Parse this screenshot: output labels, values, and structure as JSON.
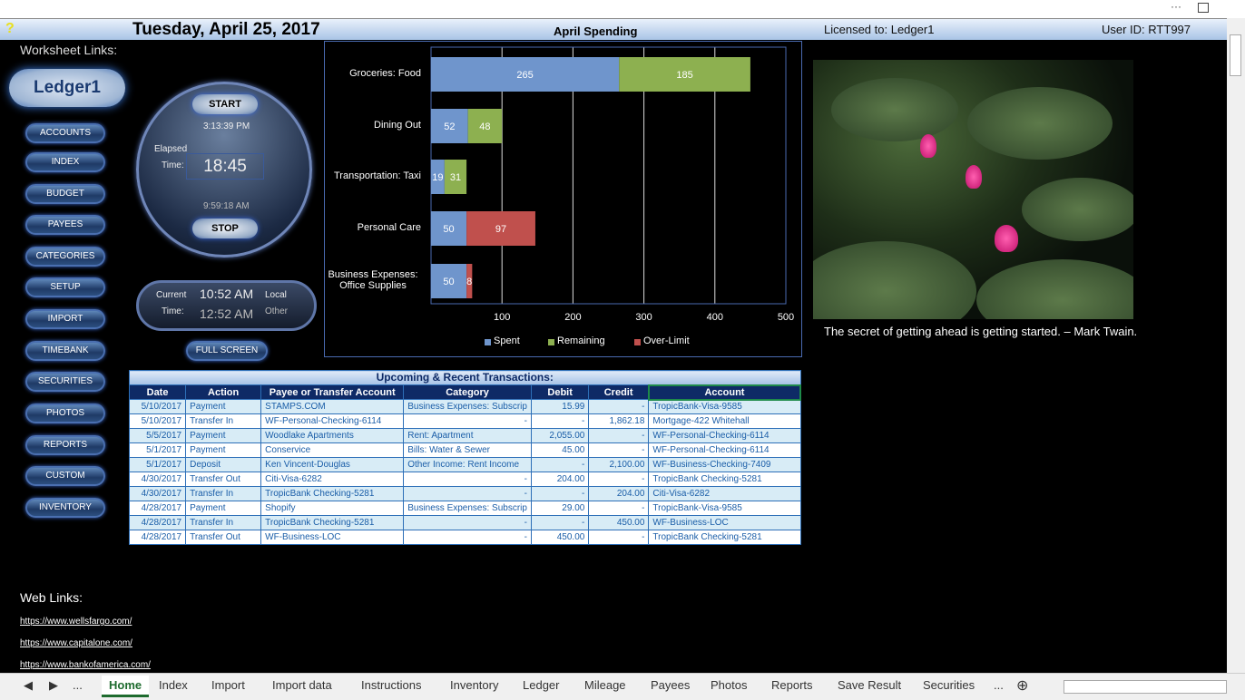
{
  "window": {
    "menu_icon": "more-options-icon",
    "restore_icon": "restore-window-icon"
  },
  "header": {
    "help_icon": "?",
    "date": "Tuesday, April 25, 2017",
    "licensed": "Licensed to:  Ledger1",
    "user": "User ID:  RTT997"
  },
  "sidebar": {
    "title": "Worksheet Links:",
    "logo": "Ledger1",
    "items": [
      "ACCOUNTS",
      "INDEX",
      "BUDGET",
      "PAYEES",
      "CATEGORIES",
      "SETUP",
      "IMPORT",
      "TIMEBANK",
      "SECURITIES",
      "PHOTOS",
      "REPORTS",
      "CUSTOM",
      "INVENTORY"
    ]
  },
  "timer": {
    "start": "START",
    "start_time": "3:13:39 PM",
    "elapsed_l1": "Elapsed",
    "elapsed_l2": "Time:",
    "elapsed": "18:45",
    "stop_time": "9:59:18 AM",
    "stop": "STOP"
  },
  "current": {
    "l1": "Current",
    "l2": "Time:",
    "local": "10:52 AM",
    "other": "12:52 AM",
    "local_l": "Local",
    "other_l": "Other"
  },
  "full_screen": "FULL SCREEN",
  "chart_data": {
    "type": "bar",
    "orientation": "horizontal",
    "stacked": true,
    "title": "April Spending",
    "categories": [
      "Groceries: Food",
      "Dining Out",
      "Transportation: Taxi",
      "Personal Care",
      "Business Expenses: Office Supplies"
    ],
    "series": [
      {
        "name": "Spent",
        "color": "#6f95cc",
        "values": [
          265,
          52,
          19,
          50,
          50
        ]
      },
      {
        "name": "Remaining",
        "color": "#8db050",
        "values": [
          185,
          48,
          31,
          0,
          0
        ]
      },
      {
        "name": "Over-Limit",
        "color": "#c0504d",
        "values": [
          0,
          0,
          0,
          97,
          8
        ]
      }
    ],
    "xlim": [
      0,
      500
    ],
    "xticks": [
      "100",
      "200",
      "300",
      "400",
      "500"
    ],
    "grid": true,
    "legend": "bottom"
  },
  "quote": "The secret of getting ahead is getting started. – Mark Twain.",
  "transactions": {
    "title": "Upcoming & Recent Transactions:",
    "columns": [
      "Date",
      "Action",
      "Payee or Transfer Account",
      "Category",
      "Debit",
      "Credit",
      "Account"
    ],
    "rows": [
      [
        "5/10/2017",
        "Payment",
        "STAMPS.COM",
        "Business Expenses: Subscrip",
        "15.99",
        "-",
        "TropicBank-Visa-9585"
      ],
      [
        "5/10/2017",
        "Transfer In",
        "WF-Personal-Checking-6114",
        "-",
        "-",
        "1,862.18",
        "Mortgage-422 Whitehall"
      ],
      [
        "5/5/2017",
        "Payment",
        "Woodlake Apartments",
        "Rent: Apartment",
        "2,055.00",
        "-",
        "WF-Personal-Checking-6114"
      ],
      [
        "5/1/2017",
        "Payment",
        "Conservice",
        "Bills: Water & Sewer",
        "45.00",
        "-",
        "WF-Personal-Checking-6114"
      ],
      [
        "5/1/2017",
        "Deposit",
        "Ken Vincent-Douglas",
        "Other Income: Rent Income",
        "-",
        "2,100.00",
        "WF-Business-Checking-7409"
      ],
      [
        "4/30/2017",
        "Transfer Out",
        "Citi-Visa-6282",
        "-",
        "204.00",
        "-",
        "TropicBank Checking-5281"
      ],
      [
        "4/30/2017",
        "Transfer In",
        "TropicBank Checking-5281",
        "-",
        "-",
        "204.00",
        "Citi-Visa-6282"
      ],
      [
        "4/28/2017",
        "Payment",
        "Shopify",
        "Business Expenses: Subscrip",
        "29.00",
        "-",
        "TropicBank-Visa-9585"
      ],
      [
        "4/28/2017",
        "Transfer In",
        "TropicBank Checking-5281",
        "-",
        "-",
        "450.00",
        "WF-Business-LOC"
      ],
      [
        "4/28/2017",
        "Transfer Out",
        "WF-Business-LOC",
        "-",
        "450.00",
        "-",
        "TropicBank Checking-5281"
      ]
    ]
  },
  "web": {
    "title": "Web Links:",
    "links": [
      "https://www.wellsfargo.com/",
      "https://www.capitalone.com/",
      "https://www.bankofamerica.com/"
    ]
  },
  "tabs": {
    "items": [
      "Home",
      "Index",
      "Import",
      "Import data",
      "Instructions",
      "Inventory",
      "Ledger",
      "Mileage",
      "Payees",
      "Photos",
      "Reports",
      "Save Result",
      "Securities"
    ],
    "active": "Home",
    "more": "...",
    "ellipsis_left": "..."
  }
}
